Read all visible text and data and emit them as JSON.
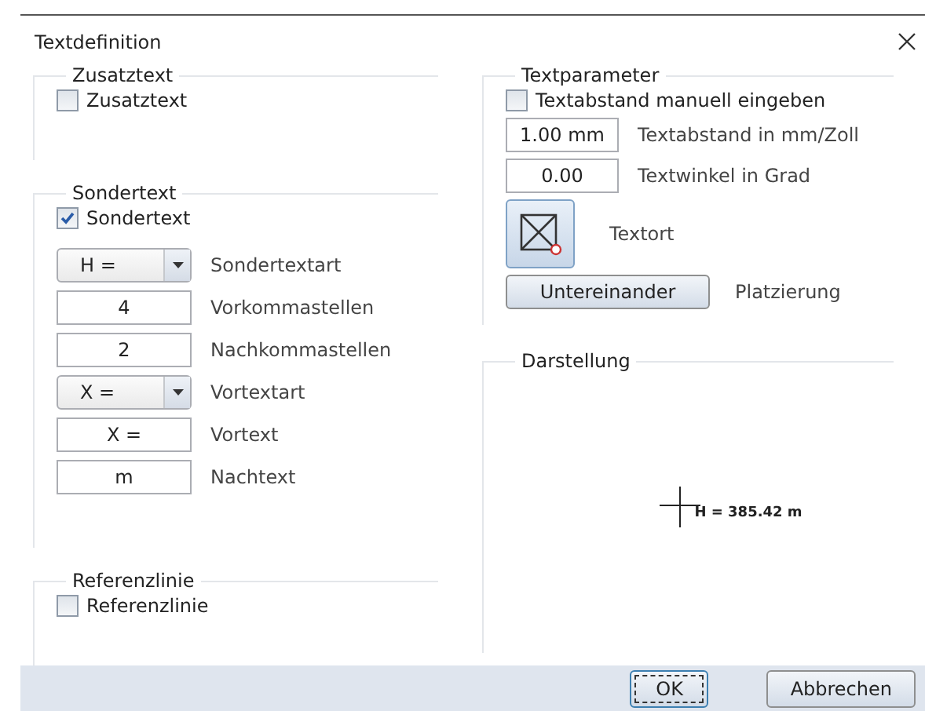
{
  "window": {
    "title": "Textdefinition"
  },
  "left": [
    {
      "kind": "simple",
      "legend": "Zusatztext",
      "checkbox": {
        "label": "Zusatztext",
        "checked": false
      }
    },
    {
      "kind": "fields",
      "legend": "Sondertext",
      "checkbox": {
        "label": "Sondertext",
        "checked": true
      },
      "fields": [
        {
          "kind": "dropdown",
          "value": "H =",
          "label": "Sondertextart"
        },
        {
          "kind": "input",
          "value": "4",
          "label": "Vorkommastellen"
        },
        {
          "kind": "input",
          "value": "2",
          "label": "Nachkommastellen"
        },
        {
          "kind": "dropdown",
          "value": "X =",
          "label": "Vortextart"
        },
        {
          "kind": "input",
          "value": "X =",
          "label": "Vortext"
        },
        {
          "kind": "input",
          "value": "m",
          "label": "Nachtext"
        }
      ]
    },
    {
      "kind": "simple",
      "legend": "Referenzlinie",
      "checkbox": {
        "label": "Referenzlinie",
        "checked": false
      }
    }
  ],
  "textparameter": {
    "legend": "Textparameter",
    "checkbox": {
      "label": "Textabstand manuell eingeben",
      "checked": false
    },
    "fields": [
      {
        "value": "1.00 mm",
        "label": "Textabstand in mm/Zoll"
      },
      {
        "value": "0.00",
        "label": "Textwinkel in Grad"
      }
    ],
    "textort_label": "Textort",
    "placement": {
      "button": "Untereinander",
      "label": "Platzierung"
    }
  },
  "darstellung": {
    "legend": "Darstellung",
    "preview_text": "H = 385.42 m"
  },
  "buttons": [
    {
      "label": "OK",
      "default": true
    },
    {
      "label": "Abbrechen",
      "default": false
    }
  ]
}
